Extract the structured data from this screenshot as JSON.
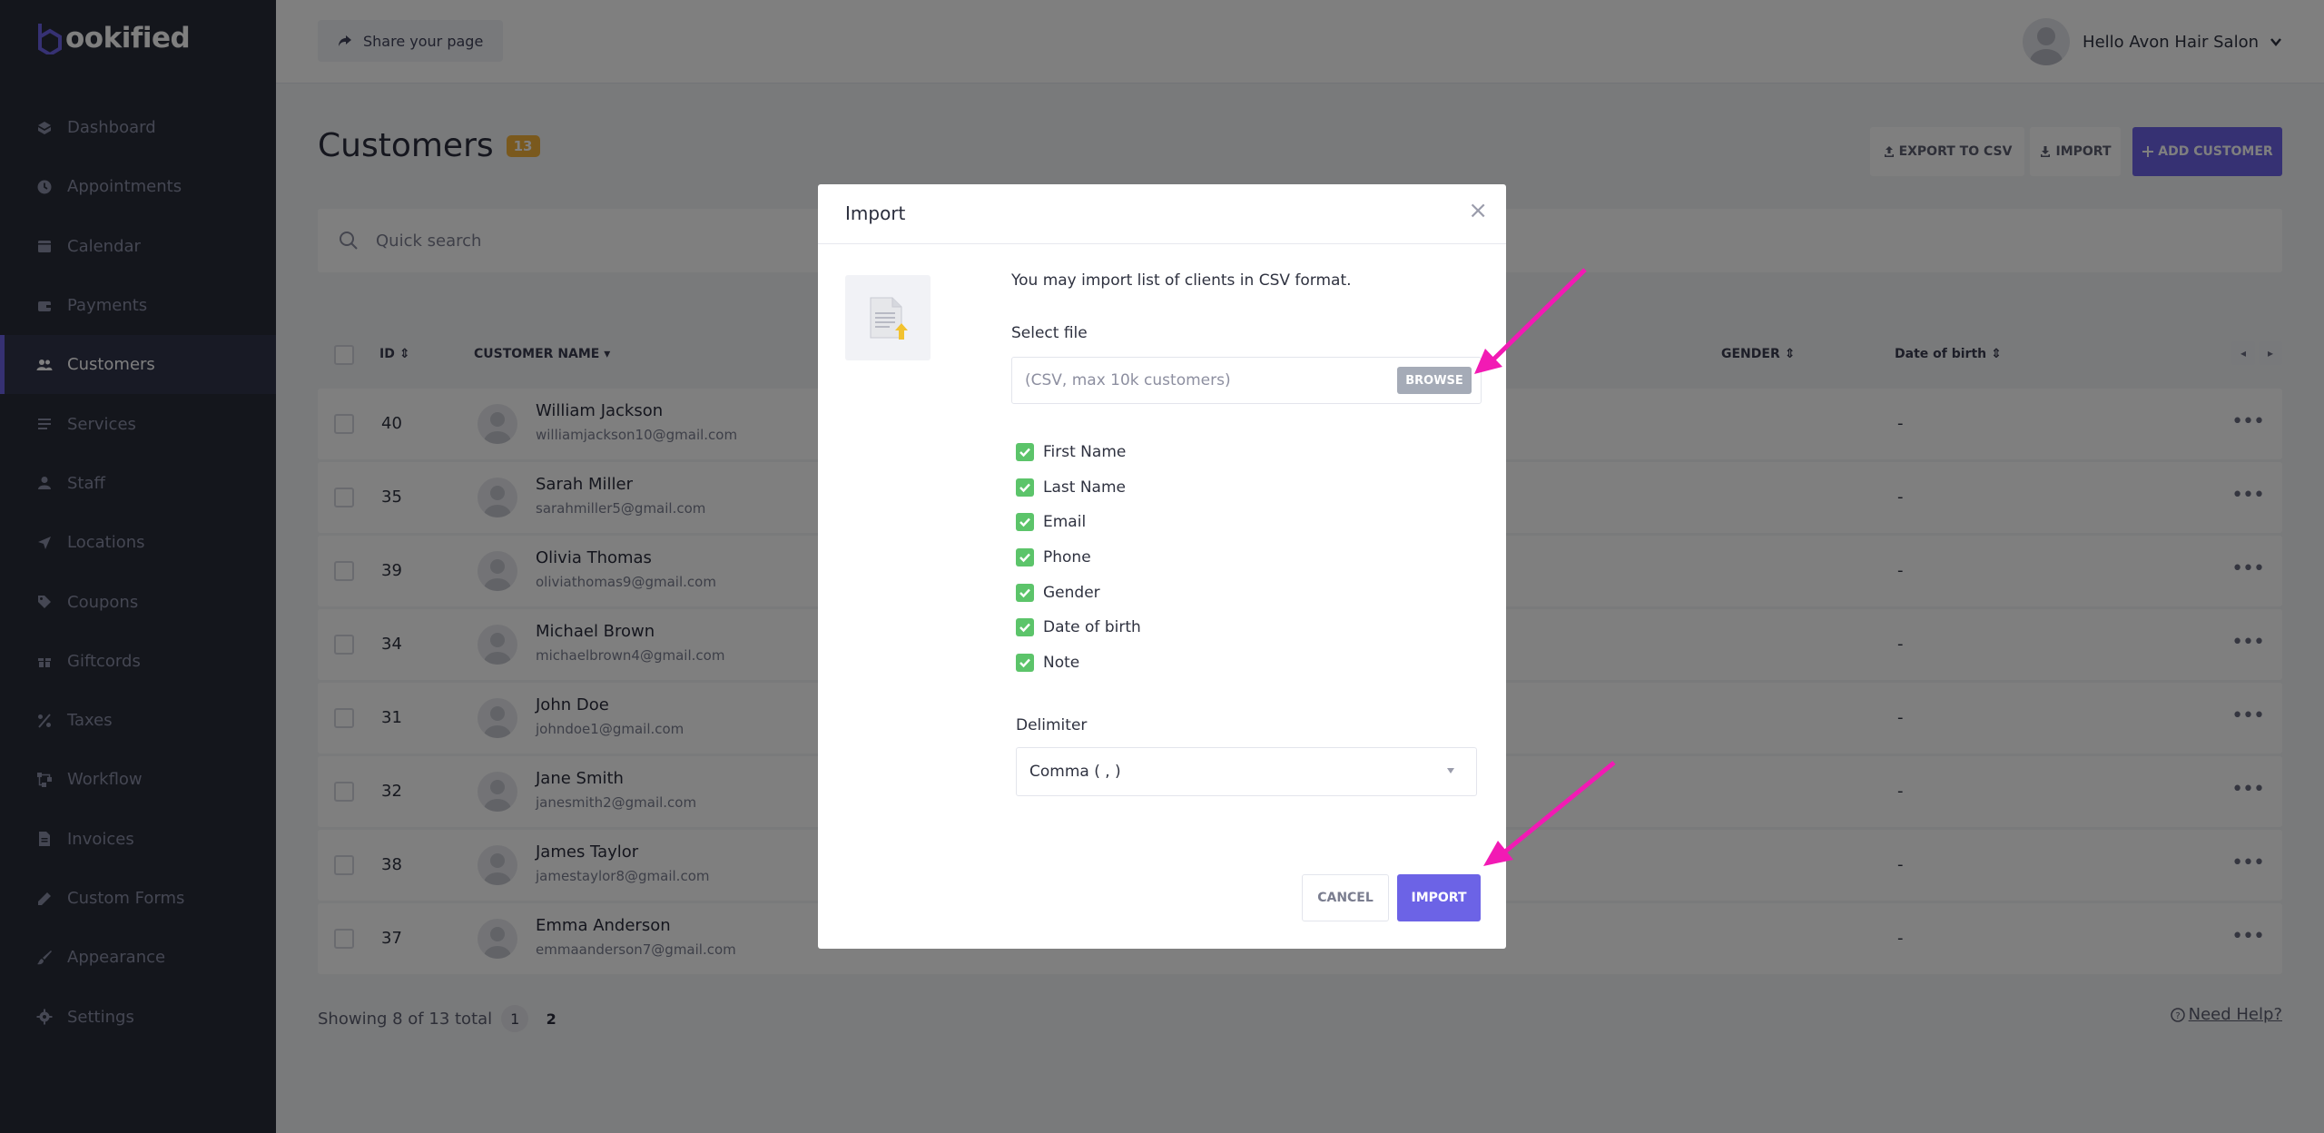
{
  "app": {
    "logo_text": "ookified",
    "brand_color": "#6c63e6"
  },
  "sidebar": {
    "items": [
      {
        "label": "Dashboard",
        "icon": "dashboard-icon",
        "active": false
      },
      {
        "label": "Appointments",
        "icon": "clock-icon",
        "active": false
      },
      {
        "label": "Calendar",
        "icon": "calendar-icon",
        "active": false
      },
      {
        "label": "Payments",
        "icon": "wallet-icon",
        "active": false
      },
      {
        "label": "Customers",
        "icon": "users-icon",
        "active": true
      },
      {
        "label": "Services",
        "icon": "list-icon",
        "active": false
      },
      {
        "label": "Staff",
        "icon": "user-icon",
        "active": false
      },
      {
        "label": "Locations",
        "icon": "location-arrow-icon",
        "active": false
      },
      {
        "label": "Coupons",
        "icon": "tag-icon",
        "active": false
      },
      {
        "label": "Giftcords",
        "icon": "gift-icon",
        "active": false
      },
      {
        "label": "Taxes",
        "icon": "percent-icon",
        "active": false
      },
      {
        "label": "Workflow",
        "icon": "workflow-icon",
        "active": false
      },
      {
        "label": "Invoices",
        "icon": "file-icon",
        "active": false
      },
      {
        "label": "Custom Forms",
        "icon": "pen-icon",
        "active": false
      },
      {
        "label": "Appearance",
        "icon": "brush-icon",
        "active": false
      },
      {
        "label": "Settings",
        "icon": "gear-icon",
        "active": false
      }
    ]
  },
  "topbar": {
    "share_label": "Share your page",
    "user_greeting": "Hello Avon Hair Salon"
  },
  "page": {
    "title": "Customers",
    "count": "13",
    "export_label": "EXPORT TO CSV",
    "import_label": "IMPORT",
    "add_label": "ADD CUSTOMER",
    "search_placeholder": "Quick search"
  },
  "table": {
    "columns": {
      "id": "ID",
      "name": "CUSTOMER NAME",
      "gender": "GENDER",
      "dob": "Date of birth"
    },
    "rows": [
      {
        "id": "40",
        "name": "William Jackson",
        "email": "williamjackson10@gmail.com",
        "dob": "-"
      },
      {
        "id": "35",
        "name": "Sarah Miller",
        "email": "sarahmiller5@gmail.com",
        "dob": "-"
      },
      {
        "id": "39",
        "name": "Olivia Thomas",
        "email": "oliviathomas9@gmail.com",
        "dob": "-"
      },
      {
        "id": "34",
        "name": "Michael Brown",
        "email": "michaelbrown4@gmail.com",
        "dob": "-"
      },
      {
        "id": "31",
        "name": "John Doe",
        "email": "johndoe1@gmail.com",
        "dob": "-"
      },
      {
        "id": "32",
        "name": "Jane Smith",
        "email": "janesmith2@gmail.com",
        "dob": "-"
      },
      {
        "id": "38",
        "name": "James Taylor",
        "email": "jamestaylor8@gmail.com",
        "dob": "-"
      },
      {
        "id": "37",
        "name": "Emma Anderson",
        "email": "emmaanderson7@gmail.com",
        "dob": "-"
      }
    ],
    "more_glyph": "•••",
    "showing_text": "Showing 8 of 13 total",
    "current_page": "1",
    "next_page": "2",
    "help_label": "Need Help?"
  },
  "modal": {
    "title": "Import",
    "close_glyph": "×",
    "info": "You may import list of clients in CSV format.",
    "select_file_label": "Select file",
    "file_placeholder": "(CSV, max 10k customers)",
    "browse_label": "BROWSE",
    "fields": [
      "First Name",
      "Last Name",
      "Email",
      "Phone",
      "Gender",
      "Date of birth",
      "Note"
    ],
    "delimiter_label": "Delimiter",
    "delimiter_value": "Comma ( , )",
    "cancel_label": "CANCEL",
    "import_label": "IMPORT"
  },
  "annotation": {
    "arrow_color": "#f21ab4"
  }
}
